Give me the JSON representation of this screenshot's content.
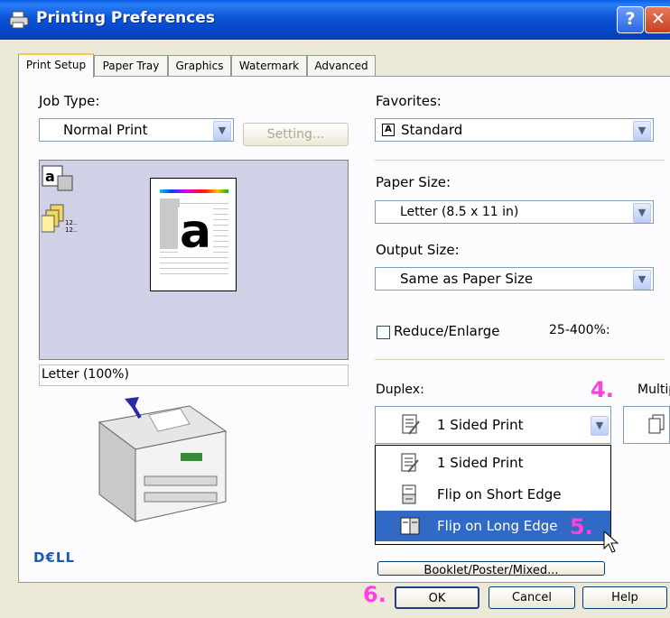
{
  "window": {
    "title": "Printing Preferences",
    "help_glyph": "?",
    "close_glyph": "✕"
  },
  "tabs": [
    "Print Setup",
    "Paper Tray",
    "Graphics",
    "Watermark",
    "Advanced"
  ],
  "job_type": {
    "label": "Job Type:",
    "value": "Normal Print",
    "setting_button": "Setting..."
  },
  "preview": {
    "status": "Letter (100%)",
    "badge_text": "12..\n12.."
  },
  "brand": "D€LL",
  "favorites": {
    "label": "Favorites:",
    "glyph": "A",
    "value": "Standard"
  },
  "paper_size": {
    "label": "Paper Size:",
    "value": "Letter (8.5 x 11 in)"
  },
  "output_size": {
    "label": "Output Size:",
    "value": "Same as Paper Size"
  },
  "reduce_enlarge": {
    "label": "Reduce/Enlarge",
    "range": "25-400%:",
    "checked": false
  },
  "duplex": {
    "label": "Duplex:",
    "value": "1 Sided Print",
    "options": [
      "1 Sided Print",
      "Flip on Short Edge",
      "Flip on Long Edge"
    ],
    "highlighted": "Flip on Long Edge"
  },
  "multiple_up": {
    "label": "Multip"
  },
  "steps": {
    "four": "4.",
    "five": "5.",
    "six": "6."
  },
  "hidden_button": {
    "label": "Booklet/Poster/Mixed..."
  },
  "dialog_buttons": {
    "ok": "OK",
    "cancel": "Cancel",
    "help": "Help"
  },
  "colors": {
    "titlebar": "#0b54d8",
    "selection": "#316ac5",
    "step_marker": "#ff40e0",
    "preview_bg": "#d0d0e6"
  }
}
